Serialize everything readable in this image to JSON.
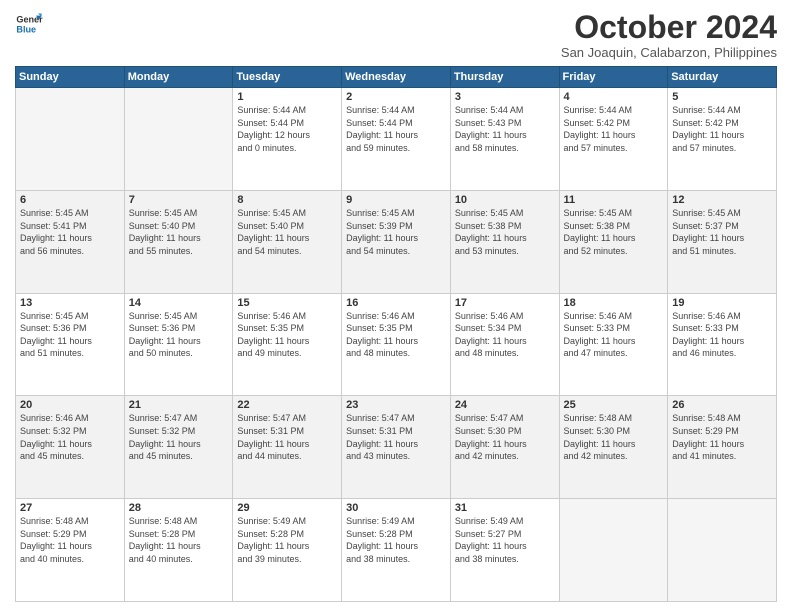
{
  "header": {
    "logo_line1": "General",
    "logo_line2": "Blue",
    "month": "October 2024",
    "location": "San Joaquin, Calabarzon, Philippines"
  },
  "columns": [
    "Sunday",
    "Monday",
    "Tuesday",
    "Wednesday",
    "Thursday",
    "Friday",
    "Saturday"
  ],
  "weeks": [
    [
      {
        "day": "",
        "detail": ""
      },
      {
        "day": "",
        "detail": ""
      },
      {
        "day": "1",
        "detail": "Sunrise: 5:44 AM\nSunset: 5:44 PM\nDaylight: 12 hours\nand 0 minutes."
      },
      {
        "day": "2",
        "detail": "Sunrise: 5:44 AM\nSunset: 5:44 PM\nDaylight: 11 hours\nand 59 minutes."
      },
      {
        "day": "3",
        "detail": "Sunrise: 5:44 AM\nSunset: 5:43 PM\nDaylight: 11 hours\nand 58 minutes."
      },
      {
        "day": "4",
        "detail": "Sunrise: 5:44 AM\nSunset: 5:42 PM\nDaylight: 11 hours\nand 57 minutes."
      },
      {
        "day": "5",
        "detail": "Sunrise: 5:44 AM\nSunset: 5:42 PM\nDaylight: 11 hours\nand 57 minutes."
      }
    ],
    [
      {
        "day": "6",
        "detail": "Sunrise: 5:45 AM\nSunset: 5:41 PM\nDaylight: 11 hours\nand 56 minutes."
      },
      {
        "day": "7",
        "detail": "Sunrise: 5:45 AM\nSunset: 5:40 PM\nDaylight: 11 hours\nand 55 minutes."
      },
      {
        "day": "8",
        "detail": "Sunrise: 5:45 AM\nSunset: 5:40 PM\nDaylight: 11 hours\nand 54 minutes."
      },
      {
        "day": "9",
        "detail": "Sunrise: 5:45 AM\nSunset: 5:39 PM\nDaylight: 11 hours\nand 54 minutes."
      },
      {
        "day": "10",
        "detail": "Sunrise: 5:45 AM\nSunset: 5:38 PM\nDaylight: 11 hours\nand 53 minutes."
      },
      {
        "day": "11",
        "detail": "Sunrise: 5:45 AM\nSunset: 5:38 PM\nDaylight: 11 hours\nand 52 minutes."
      },
      {
        "day": "12",
        "detail": "Sunrise: 5:45 AM\nSunset: 5:37 PM\nDaylight: 11 hours\nand 51 minutes."
      }
    ],
    [
      {
        "day": "13",
        "detail": "Sunrise: 5:45 AM\nSunset: 5:36 PM\nDaylight: 11 hours\nand 51 minutes."
      },
      {
        "day": "14",
        "detail": "Sunrise: 5:45 AM\nSunset: 5:36 PM\nDaylight: 11 hours\nand 50 minutes."
      },
      {
        "day": "15",
        "detail": "Sunrise: 5:46 AM\nSunset: 5:35 PM\nDaylight: 11 hours\nand 49 minutes."
      },
      {
        "day": "16",
        "detail": "Sunrise: 5:46 AM\nSunset: 5:35 PM\nDaylight: 11 hours\nand 48 minutes."
      },
      {
        "day": "17",
        "detail": "Sunrise: 5:46 AM\nSunset: 5:34 PM\nDaylight: 11 hours\nand 48 minutes."
      },
      {
        "day": "18",
        "detail": "Sunrise: 5:46 AM\nSunset: 5:33 PM\nDaylight: 11 hours\nand 47 minutes."
      },
      {
        "day": "19",
        "detail": "Sunrise: 5:46 AM\nSunset: 5:33 PM\nDaylight: 11 hours\nand 46 minutes."
      }
    ],
    [
      {
        "day": "20",
        "detail": "Sunrise: 5:46 AM\nSunset: 5:32 PM\nDaylight: 11 hours\nand 45 minutes."
      },
      {
        "day": "21",
        "detail": "Sunrise: 5:47 AM\nSunset: 5:32 PM\nDaylight: 11 hours\nand 45 minutes."
      },
      {
        "day": "22",
        "detail": "Sunrise: 5:47 AM\nSunset: 5:31 PM\nDaylight: 11 hours\nand 44 minutes."
      },
      {
        "day": "23",
        "detail": "Sunrise: 5:47 AM\nSunset: 5:31 PM\nDaylight: 11 hours\nand 43 minutes."
      },
      {
        "day": "24",
        "detail": "Sunrise: 5:47 AM\nSunset: 5:30 PM\nDaylight: 11 hours\nand 42 minutes."
      },
      {
        "day": "25",
        "detail": "Sunrise: 5:48 AM\nSunset: 5:30 PM\nDaylight: 11 hours\nand 42 minutes."
      },
      {
        "day": "26",
        "detail": "Sunrise: 5:48 AM\nSunset: 5:29 PM\nDaylight: 11 hours\nand 41 minutes."
      }
    ],
    [
      {
        "day": "27",
        "detail": "Sunrise: 5:48 AM\nSunset: 5:29 PM\nDaylight: 11 hours\nand 40 minutes."
      },
      {
        "day": "28",
        "detail": "Sunrise: 5:48 AM\nSunset: 5:28 PM\nDaylight: 11 hours\nand 40 minutes."
      },
      {
        "day": "29",
        "detail": "Sunrise: 5:49 AM\nSunset: 5:28 PM\nDaylight: 11 hours\nand 39 minutes."
      },
      {
        "day": "30",
        "detail": "Sunrise: 5:49 AM\nSunset: 5:28 PM\nDaylight: 11 hours\nand 38 minutes."
      },
      {
        "day": "31",
        "detail": "Sunrise: 5:49 AM\nSunset: 5:27 PM\nDaylight: 11 hours\nand 38 minutes."
      },
      {
        "day": "",
        "detail": ""
      },
      {
        "day": "",
        "detail": ""
      }
    ]
  ]
}
